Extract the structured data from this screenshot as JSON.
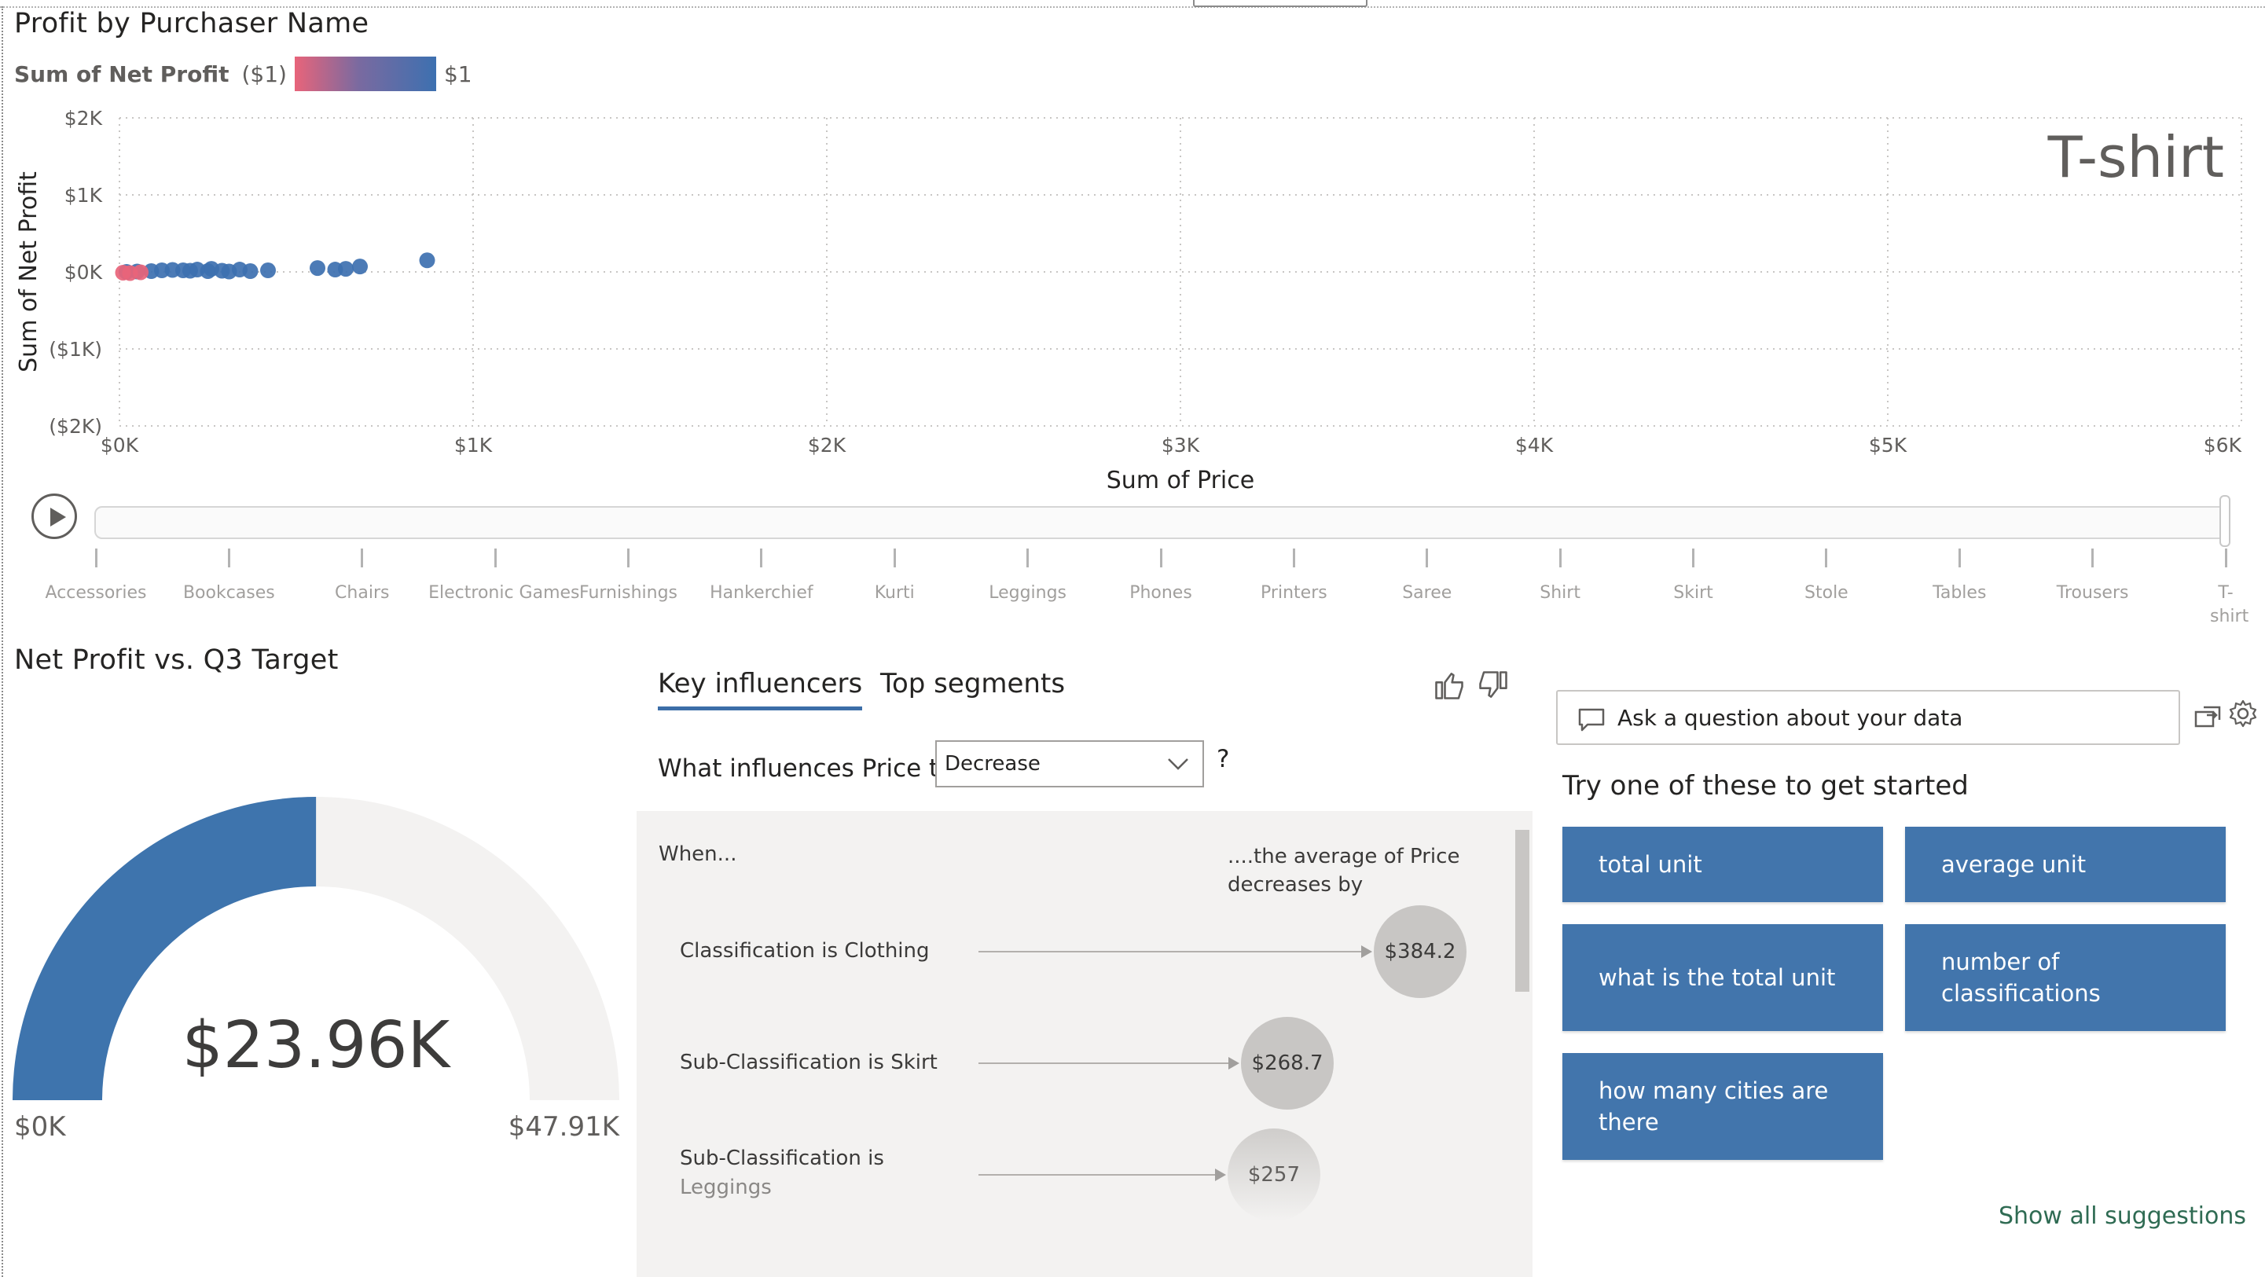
{
  "scatter": {
    "title": "Profit by Purchaser Name",
    "legend": {
      "title": "Sum of Net Profit",
      "min": "($1)",
      "max": "$1",
      "gradient_start": "#e8647a",
      "gradient_end": "#3d70b0"
    },
    "watermark": "T-shirt",
    "play_axis": [
      "Accessories",
      "Bookcases",
      "Chairs",
      "Electronic Games",
      "Furnishings",
      "Hankerchief",
      "Kurti",
      "Leggings",
      "Phones",
      "Printers",
      "Saree",
      "Shirt",
      "Skirt",
      "Stole",
      "Tables",
      "Trousers",
      "T-shirt"
    ]
  },
  "chart_data": {
    "type": "scatter",
    "title": "Profit by Purchaser Name",
    "xlabel": "Sum of Price",
    "ylabel": "Sum of Net Profit",
    "xlim": [
      0,
      6000
    ],
    "ylim": [
      -2000,
      2000
    ],
    "x_ticks": [
      "$0K",
      "$1K",
      "$2K",
      "$3K",
      "$4K",
      "$5K",
      "$6K"
    ],
    "y_ticks": [
      "$2K",
      "$1K",
      "$0K",
      "($1K)",
      "($2K)"
    ],
    "grid": true,
    "series": [
      {
        "color": "#3d70b0",
        "points": [
          [
            20,
            0
          ],
          [
            50,
            5
          ],
          [
            90,
            10
          ],
          [
            120,
            20
          ],
          [
            150,
            25
          ],
          [
            180,
            20
          ],
          [
            200,
            15
          ],
          [
            220,
            30
          ],
          [
            250,
            10
          ],
          [
            260,
            40
          ],
          [
            290,
            15
          ],
          [
            310,
            5
          ],
          [
            340,
            30
          ],
          [
            370,
            10
          ],
          [
            420,
            20
          ],
          [
            560,
            50
          ],
          [
            610,
            30
          ],
          [
            640,
            40
          ],
          [
            680,
            70
          ],
          [
            870,
            150
          ]
        ]
      },
      {
        "color": "#e8647a",
        "points": [
          [
            10,
            -10
          ],
          [
            30,
            -15
          ],
          [
            60,
            -5
          ]
        ]
      }
    ]
  },
  "gauge": {
    "title": "Net Profit vs. Q3 Target",
    "value": 23960,
    "max": 47910,
    "value_label": "$23.96K",
    "min_label": "$0K",
    "max_label": "$47.91K",
    "fill_color": "#3e74ad",
    "track_color": "#f3f2f1"
  },
  "key_influencers": {
    "tabs": [
      "Key influencers",
      "Top segments"
    ],
    "question_prefix": "What influences Price to",
    "dropdown_value": "Decrease",
    "help": "?",
    "col_when": "When...",
    "col_avg": "....the average of Price decreases by",
    "rows": [
      {
        "label": "Classification is Clothing",
        "label_sub": "",
        "value": "$384.2",
        "amount": 384.2
      },
      {
        "label": "Sub-Classification is Skirt",
        "label_sub": "",
        "value": "$268.7",
        "amount": 268.7
      },
      {
        "label": "Sub-Classification is",
        "label_sub": "Leggings",
        "value": "$257",
        "amount": 257
      }
    ]
  },
  "qa": {
    "placeholder": "Ask a question about your data",
    "prompt": "Try one of these to get started",
    "suggestions": [
      "total unit",
      "average unit",
      "what is the total unit",
      "number of classifications",
      "how many cities are there"
    ],
    "show_all": "Show all suggestions"
  }
}
